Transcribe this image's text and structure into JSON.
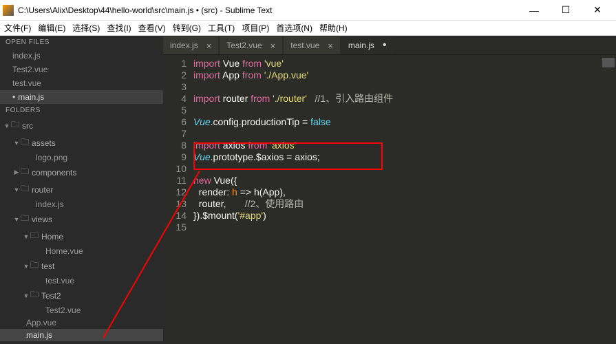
{
  "title": "C:\\Users\\Alix\\Desktop\\44\\hello-world\\src\\main.js • (src) - Sublime Text",
  "winbtns": {
    "min": "—",
    "max": "☐",
    "close": "✕"
  },
  "menus": [
    "文件(F)",
    "编辑(E)",
    "选择(S)",
    "查找(I)",
    "查看(V)",
    "转到(G)",
    "工具(T)",
    "项目(P)",
    "首选项(N)",
    "帮助(H)"
  ],
  "side": {
    "open_header": "OPEN FILES",
    "open_files": [
      "index.js",
      "Test2.vue",
      "test.vue"
    ],
    "open_active": "main.js",
    "folders_header": "FOLDERS",
    "tree": {
      "src": "src",
      "assets": "assets",
      "logo": "logo.png",
      "components": "components",
      "router": "router",
      "router_index": "index.js",
      "views": "views",
      "home": "Home",
      "home_vue": "Home.vue",
      "test": "test",
      "test_vue": "test.vue",
      "test2": "Test2",
      "test2_vue": "Test2.vue",
      "app_vue": "App.vue",
      "main_js": "main.js"
    }
  },
  "tabs": [
    {
      "label": "index.js",
      "active": false,
      "dirty": false
    },
    {
      "label": "Test2.vue",
      "active": false,
      "dirty": false
    },
    {
      "label": "test.vue",
      "active": false,
      "dirty": false
    },
    {
      "label": "main.js",
      "active": true,
      "dirty": true
    }
  ],
  "code": {
    "numbers": [
      "1",
      "2",
      "3",
      "4",
      "5",
      "6",
      "7",
      "8",
      "9",
      "10",
      "11",
      "12",
      "13",
      "14",
      "15"
    ],
    "k_import": "import",
    "k_from": "from",
    "k_new": "new",
    "Vue": "Vue",
    "App": "App",
    "router": "router",
    "axios": "axios",
    "s_vue": "'vue'",
    "s_appvue": "'./App.vue'",
    "s_router": "'./router'",
    "s_axios": "'axios'",
    "s_app": "'#app'",
    "c1": "//1、引入路由组件",
    "c2": "//2、使用路由",
    "configline": ".config.productionTip = ",
    "false": "false",
    "protoline": ".prototype.$axios = axios;",
    "new_open": " Vue({",
    "render": "  render",
    "render_body": ": ",
    "h": "h",
    "arrow": " => h(App),",
    "router_line": "  router,",
    "mount_close": "}).$mount(",
    "close_paren": ")"
  }
}
